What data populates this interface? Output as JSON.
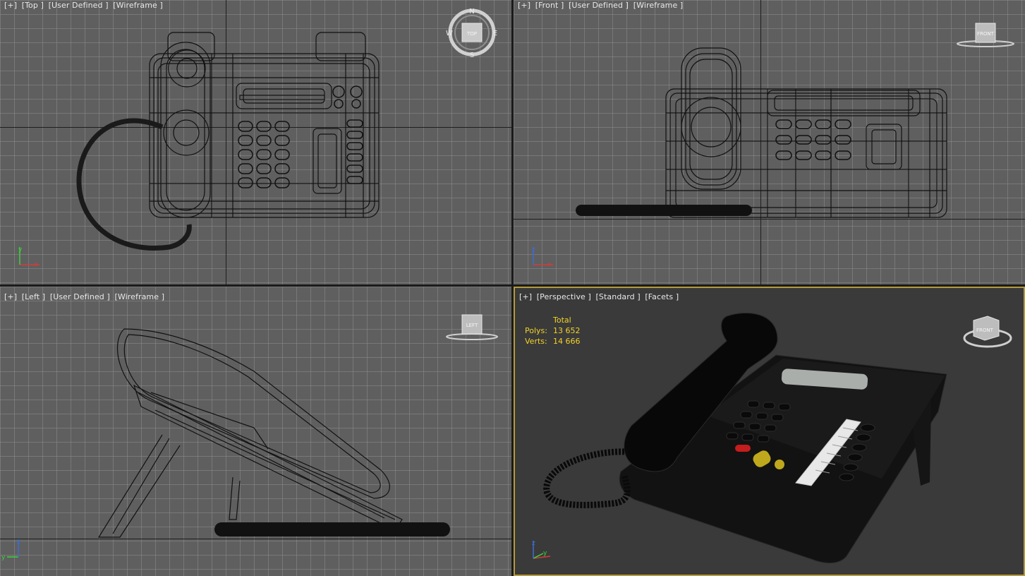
{
  "viewports": {
    "top": {
      "labels": [
        "[+]",
        "[Top ]",
        "[User Defined ]",
        "[Wireframe ]"
      ],
      "viewcube": {
        "face": "TOP",
        "compass": [
          "N",
          "S",
          "W",
          "E"
        ]
      }
    },
    "front": {
      "labels": [
        "[+]",
        "[Front ]",
        "[User Defined ]",
        "[Wireframe ]"
      ],
      "viewcube": {
        "face": "FRONT"
      }
    },
    "left": {
      "labels": [
        "[+]",
        "[Left ]",
        "[User Defined ]",
        "[Wireframe ]"
      ],
      "viewcube": {
        "face": "LEFT"
      }
    },
    "perspective": {
      "labels": [
        "[+]",
        "[Perspective ]",
        "[Standard ]",
        "[Facets ]"
      ],
      "viewcube": {
        "face": "FRONT"
      },
      "stats": {
        "header": "Total",
        "polys_label": "Polys:",
        "polys_value": "13 652",
        "verts_label": "Verts:",
        "verts_value": "14 666"
      }
    }
  },
  "axis_labels": {
    "x": "x",
    "y": "y",
    "z": "z"
  },
  "colors": {
    "wire_bg": "#5f5f5f",
    "persp_bg": "#3a3a3a",
    "active_border": "#b59a3a",
    "stats_text": "#f2d22a",
    "axis_x": "#d23c3c",
    "axis_y": "#3cd23c",
    "axis_z": "#3c6cd2"
  }
}
